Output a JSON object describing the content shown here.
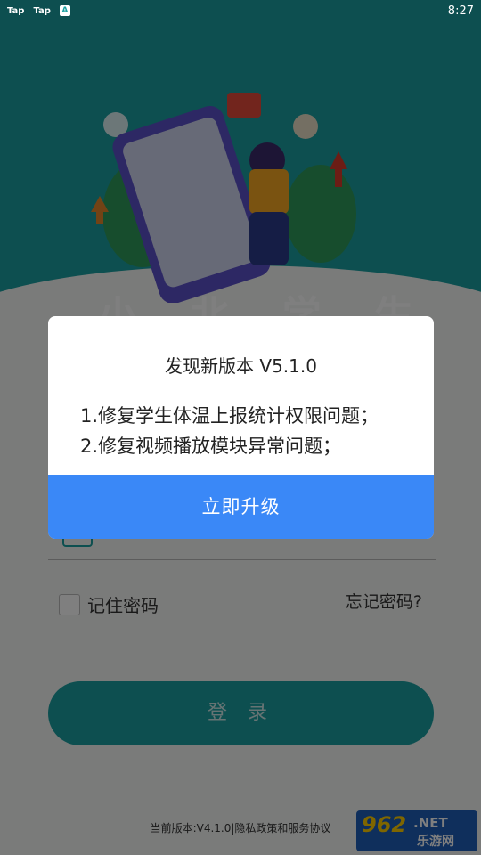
{
  "status_bar": {
    "left": [
      "Tap",
      "Tap",
      "A"
    ],
    "time": "8:27"
  },
  "brand": {
    "title": "小 北 学 生"
  },
  "dialog": {
    "title": "发现新版本 V5.1.0",
    "notes": [
      "1.修复学生体温上报统计权限问题；",
      "2.修复视频播放模块异常问题；"
    ],
    "upgrade_label": "立即升级"
  },
  "login": {
    "remember_label": "记住密码",
    "forgot_label": "忘记密码?",
    "login_label": "登 录"
  },
  "footer": {
    "text": "当前版本:V4.1.0|隐私政策和服务协议"
  },
  "watermark": {
    "num": "962",
    "net": ".NET",
    "cn": "乐游网"
  },
  "colors": {
    "teal": "#1a9fa0",
    "upgrade_blue": "#3a88f7"
  }
}
